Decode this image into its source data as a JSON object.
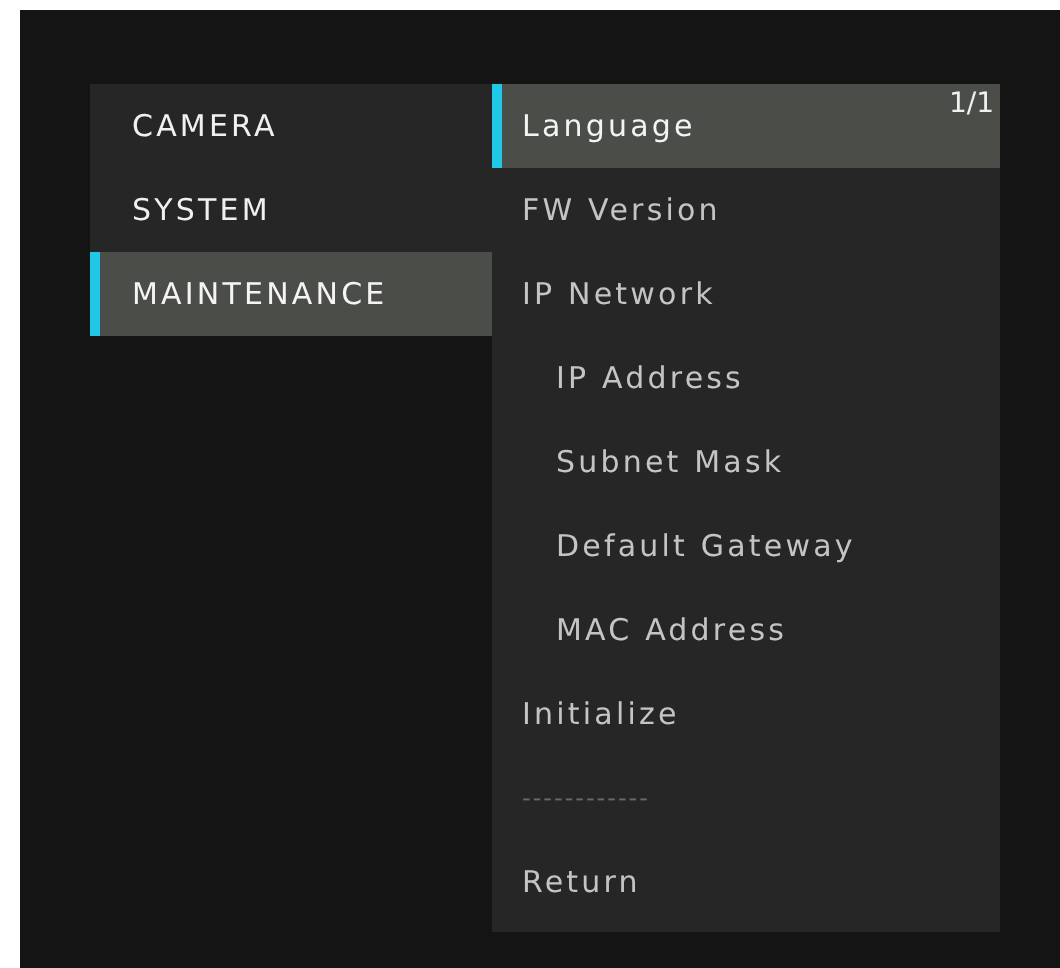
{
  "categories": [
    {
      "label": "CAMERA",
      "selected": false
    },
    {
      "label": "SYSTEM",
      "selected": false
    },
    {
      "label": "MAINTENANCE",
      "selected": true
    }
  ],
  "page_indicator": "1/1",
  "items": [
    {
      "kind": "item",
      "label": "Language",
      "selected": true
    },
    {
      "kind": "item",
      "label": "FW Version",
      "selected": false
    },
    {
      "kind": "item",
      "label": "IP Network",
      "selected": false
    },
    {
      "kind": "subitem",
      "label": "IP Address",
      "selected": false
    },
    {
      "kind": "subitem",
      "label": "Subnet Mask",
      "selected": false
    },
    {
      "kind": "subitem",
      "label": "Default Gateway",
      "selected": false
    },
    {
      "kind": "subitem",
      "label": "MAC Address",
      "selected": false
    },
    {
      "kind": "item",
      "label": "Initialize",
      "selected": false
    },
    {
      "kind": "separator",
      "label": "------------",
      "selected": false
    },
    {
      "kind": "item",
      "label": "Return",
      "selected": false
    }
  ]
}
